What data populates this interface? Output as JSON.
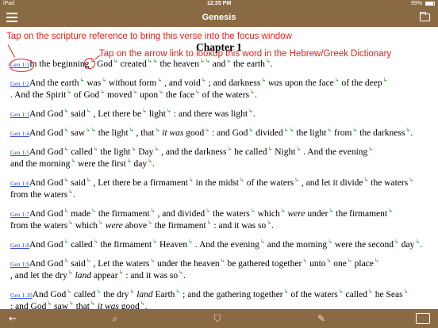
{
  "status": {
    "carrier": "iPad",
    "time": "12:35 PM",
    "battery": "99%"
  },
  "nav": {
    "title": "Genesis"
  },
  "annotations": {
    "reference_tip": "Tap on the scripture reference to bring this verse into the focus window",
    "arrow_tip": "Tap on the arrow link to lookup this word in the Hebrew/Greek Dictionary"
  },
  "chapter": {
    "title": "Chapter 1"
  },
  "verses": [
    {
      "ref": "Gen 1:1",
      "tokens": [
        {
          "t": "In the beginning",
          "a": 1
        },
        {
          "t": "God",
          "a": 1
        },
        {
          "t": "created",
          "a": 2
        },
        {
          "t": "the heaven",
          "a": 2
        },
        {
          "t": "and",
          "a": 1
        },
        {
          "t": "the earth",
          "a": 1
        },
        {
          "t": "."
        }
      ]
    },
    {
      "ref": "Gen 1:2",
      "tokens": [
        {
          "t": "And the earth",
          "a": 1
        },
        {
          "t": "was",
          "a": 1
        },
        {
          "t": "without form",
          "a": 1
        },
        {
          "t": ", and void",
          "a": 1
        },
        {
          "t": "; and darkness",
          "a": 1
        },
        {
          "t": "was",
          "i": true
        },
        {
          "t": "upon the face",
          "a": 1
        },
        {
          "t": "of the deep",
          "a": 1
        },
        {
          "t": ". And the Spirit",
          "a": 1
        },
        {
          "t": "of God",
          "a": 1
        },
        {
          "t": "moved",
          "a": 1
        },
        {
          "t": "upon",
          "a": 1
        },
        {
          "t": "the face",
          "a": 1
        },
        {
          "t": "of the waters",
          "a": 1
        },
        {
          "t": "."
        }
      ]
    },
    {
      "ref": "Gen 1:3",
      "tokens": [
        {
          "t": "And God",
          "a": 1
        },
        {
          "t": "said",
          "a": 1
        },
        {
          "t": ", Let there be",
          "a": 1
        },
        {
          "t": "light",
          "a": 1
        },
        {
          "t": ": and there was light",
          "a": 1
        },
        {
          "t": "."
        }
      ]
    },
    {
      "ref": "Gen 1:4",
      "tokens": [
        {
          "t": "And God",
          "a": 1
        },
        {
          "t": "saw",
          "a": 2
        },
        {
          "t": "the light",
          "a": 1
        },
        {
          "t": ", that",
          "a": 1
        },
        {
          "t": "it was",
          "i": true
        },
        {
          "t": "good",
          "a": 1
        },
        {
          "t": ": and God",
          "a": 1
        },
        {
          "t": "divided",
          "a": 2
        },
        {
          "t": "the light",
          "a": 1
        },
        {
          "t": "from",
          "a": 1
        },
        {
          "t": "the darkness",
          "a": 1
        },
        {
          "t": "."
        }
      ]
    },
    {
      "ref": "Gen 1:5",
      "tokens": [
        {
          "t": "And God",
          "a": 1
        },
        {
          "t": "called",
          "a": 1
        },
        {
          "t": "the light",
          "a": 1
        },
        {
          "t": "Day",
          "a": 1
        },
        {
          "t": ", and the darkness",
          "a": 1
        },
        {
          "t": "he called",
          "a": 1
        },
        {
          "t": "Night",
          "a": 1
        },
        {
          "t": ". And the evening",
          "a": 1
        },
        {
          "t": "and the morning",
          "a": 1
        },
        {
          "t": "were the first",
          "a": 1
        },
        {
          "t": "day",
          "a": 1
        },
        {
          "t": "."
        }
      ]
    },
    {
      "ref": "Gen 1:6",
      "tokens": [
        {
          "t": "And God",
          "a": 1
        },
        {
          "t": "said",
          "a": 1
        },
        {
          "t": ", Let there be a firmament",
          "a": 1
        },
        {
          "t": "in the midst",
          "a": 1
        },
        {
          "t": "of the waters",
          "a": 1
        },
        {
          "t": ", and let it divide",
          "a": 1
        },
        {
          "t": "the waters",
          "a": 1
        },
        {
          "t": "from the waters",
          "a": 1
        },
        {
          "t": "."
        }
      ]
    },
    {
      "ref": "Gen 1:7",
      "tokens": [
        {
          "t": "And God",
          "a": 1
        },
        {
          "t": "made",
          "a": 1
        },
        {
          "t": "the firmament",
          "a": 1
        },
        {
          "t": ", and divided",
          "a": 1
        },
        {
          "t": "the waters",
          "a": 1
        },
        {
          "t": "which",
          "a": 1
        },
        {
          "t": "were",
          "i": true
        },
        {
          "t": "under",
          "a": 1
        },
        {
          "t": "the firmament",
          "a": 1
        },
        {
          "t": "from the waters",
          "a": 1
        },
        {
          "t": "which",
          "a": 1
        },
        {
          "t": "were",
          "i": true
        },
        {
          "t": "above",
          "a": 1
        },
        {
          "t": "the firmament",
          "a": 1
        },
        {
          "t": ": and it was so",
          "a": 1
        },
        {
          "t": "."
        }
      ]
    },
    {
      "ref": "Gen 1:8",
      "tokens": [
        {
          "t": "And God",
          "a": 1
        },
        {
          "t": "called",
          "a": 1
        },
        {
          "t": "the firmament",
          "a": 1
        },
        {
          "t": "Heaven",
          "a": 1
        },
        {
          "t": ". And the evening",
          "a": 1
        },
        {
          "t": "and the morning",
          "a": 1
        },
        {
          "t": "were the second",
          "a": 1
        },
        {
          "t": "day",
          "a": 1
        },
        {
          "t": "."
        }
      ]
    },
    {
      "ref": "Gen 1:9",
      "tokens": [
        {
          "t": "And God",
          "a": 1
        },
        {
          "t": "said",
          "a": 1
        },
        {
          "t": ", Let the waters",
          "a": 1
        },
        {
          "t": "under the heaven",
          "a": 1
        },
        {
          "t": "be gathered together",
          "a": 1
        },
        {
          "t": "unto",
          "a": 1
        },
        {
          "t": "one",
          "a": 1
        },
        {
          "t": "place",
          "a": 1
        },
        {
          "t": ", and let the dry",
          "a": 1
        },
        {
          "t": "land",
          "i": true
        },
        {
          "t": "appear",
          "a": 1
        },
        {
          "t": ": and it was so",
          "a": 1
        },
        {
          "t": "."
        }
      ]
    },
    {
      "ref": "Gen 1:10",
      "tokens": [
        {
          "t": "And God",
          "a": 1
        },
        {
          "t": "called",
          "a": 1
        },
        {
          "t": "the dry",
          "a": 1
        },
        {
          "t": "land",
          "i": true
        },
        {
          "t": "Earth",
          "a": 1
        },
        {
          "t": "; and the gathering together",
          "a": 1
        },
        {
          "t": "of the waters",
          "a": 1
        },
        {
          "t": "called",
          "a": 1
        },
        {
          "t": "he Seas",
          "a": 1
        },
        {
          "t": ": and God",
          "a": 1
        },
        {
          "t": "saw",
          "a": 1
        },
        {
          "t": "that",
          "a": 1
        },
        {
          "t": "it was",
          "i": true
        },
        {
          "t": "good",
          "a": 1
        },
        {
          "t": "."
        }
      ]
    }
  ],
  "toolbar": {
    "back_icon": "arrow-left-icon",
    "search_icon": "search-icon",
    "tag_icon": "tag-icon",
    "edit_icon": "edit-icon",
    "book_icon": "book-icon"
  },
  "colors": {
    "bar": "#8a6a44",
    "annotation": "#e32119",
    "link": "#2b4bd3",
    "arrow": "#3a9a3a"
  }
}
